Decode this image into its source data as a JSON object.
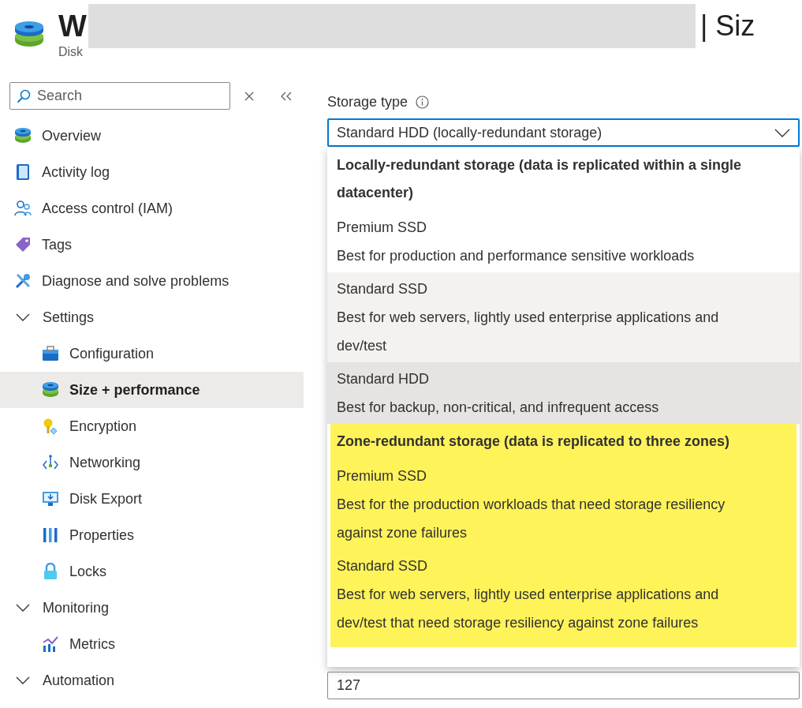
{
  "header": {
    "title_start": "W",
    "title_end": "| Siz",
    "subtitle": "Disk"
  },
  "sidebar": {
    "search": {
      "placeholder": "Search"
    },
    "items": [
      {
        "kind": "item",
        "label": "Overview",
        "selected": false
      },
      {
        "kind": "item",
        "label": "Activity log",
        "selected": false
      },
      {
        "kind": "item",
        "label": "Access control (IAM)",
        "selected": false
      },
      {
        "kind": "item",
        "label": "Tags",
        "selected": false
      },
      {
        "kind": "item",
        "label": "Diagnose and solve problems",
        "selected": false
      },
      {
        "kind": "group",
        "label": "Settings",
        "expanded": true,
        "children": [
          {
            "kind": "item",
            "label": "Configuration",
            "selected": false
          },
          {
            "kind": "item",
            "label": "Size + performance",
            "selected": true
          },
          {
            "kind": "item",
            "label": "Encryption",
            "selected": false
          },
          {
            "kind": "item",
            "label": "Networking",
            "selected": false
          },
          {
            "kind": "item",
            "label": "Disk Export",
            "selected": false
          },
          {
            "kind": "item",
            "label": "Properties",
            "selected": false
          },
          {
            "kind": "item",
            "label": "Locks",
            "selected": false
          }
        ]
      },
      {
        "kind": "group",
        "label": "Monitoring",
        "expanded": true,
        "children": [
          {
            "kind": "item",
            "label": "Metrics",
            "selected": false
          }
        ]
      },
      {
        "kind": "group",
        "label": "Automation",
        "expanded": true
      }
    ]
  },
  "storage_type": {
    "label": "Storage type",
    "value": "Standard HDD (locally-redundant storage)",
    "groups": [
      {
        "heading": "Locally-redundant storage (data is replicated within a single datacenter)",
        "highlighted": false,
        "options": [
          {
            "name": "Premium SSD",
            "description": "Best for production and performance sensitive workloads",
            "selected": false,
            "hovered": false
          },
          {
            "name": "Standard SSD",
            "description": "Best for web servers, lightly used enterprise applications and dev/test",
            "selected": false,
            "hovered": true
          },
          {
            "name": "Standard HDD",
            "description": "Best for backup, non-critical, and infrequent access",
            "selected": true,
            "hovered": false
          }
        ]
      },
      {
        "heading": "Zone-redundant storage (data is replicated to three zones)",
        "highlighted": true,
        "options": [
          {
            "name": "Premium SSD",
            "description": "Best for the production workloads that need storage resiliency against zone failures",
            "selected": false,
            "hovered": false
          },
          {
            "name": "Standard SSD",
            "description": "Best for web servers, lightly used enterprise applications and dev/test that need storage resiliency against zone failures",
            "selected": false,
            "hovered": false
          }
        ]
      }
    ]
  },
  "size_field": {
    "value": "127"
  }
}
